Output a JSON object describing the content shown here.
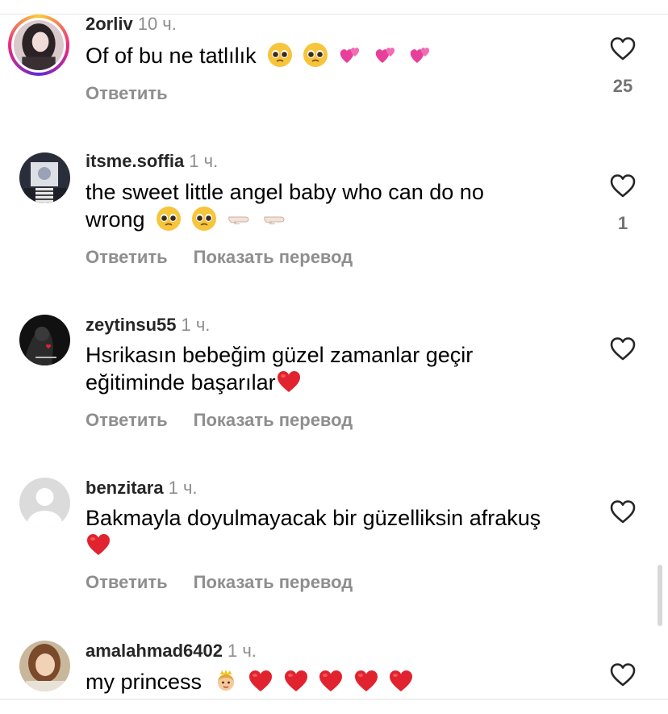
{
  "comments": [
    {
      "username": "2orliv",
      "time": "10 ч.",
      "text": "Of of bu ne tatlılık",
      "emojis": [
        "pleading-face",
        "pleading-face",
        "two-hearts",
        "two-hearts",
        "two-hearts"
      ],
      "reply_label": "Ответить",
      "translate_label": "",
      "likes": "25",
      "avatar_icon": "user-photo-story-ring"
    },
    {
      "username": "itsme.soffia",
      "time": "1 ч.",
      "text_line1": "the sweet little angel baby who can do no",
      "text_line2": "wrong",
      "emojis": [
        "pleading-face",
        "pleading-face",
        "pointing-hand",
        "pointing-hand"
      ],
      "reply_label": "Ответить",
      "translate_label": "Показать перевод",
      "likes": "1",
      "avatar_icon": "user-photo"
    },
    {
      "username": "zeytinsu55",
      "time": "1 ч.",
      "text_line1": "Hsrikasın bebeğim güzel zamanlar geçir",
      "text_line2": "eğitiminde başarılar",
      "emojis": [
        "red-heart"
      ],
      "reply_label": "Ответить",
      "translate_label": "Показать перевод",
      "likes": "",
      "avatar_icon": "user-photo-dark"
    },
    {
      "username": "benzitara",
      "time": "1 ч.",
      "text_line1": "Bakmayla doyulmayacak bir güzelliksin afrakuş",
      "emojis": [
        "red-heart"
      ],
      "reply_label": "Ответить",
      "translate_label": "Показать перевод",
      "likes": "",
      "avatar_icon": "default-avatar"
    },
    {
      "username": "amalahmad6402",
      "time": "1 ч.",
      "text": "my princess",
      "emojis": [
        "princess",
        "red-heart",
        "red-heart",
        "red-heart",
        "red-heart",
        "red-heart"
      ],
      "reply_label": "",
      "translate_label": "",
      "likes": "",
      "avatar_icon": "user-photo"
    }
  ],
  "colors": {
    "username": "#262626",
    "secondary": "#8e8e8e",
    "heart_red": "#e0232f",
    "two_hearts": "#e83f9a"
  }
}
